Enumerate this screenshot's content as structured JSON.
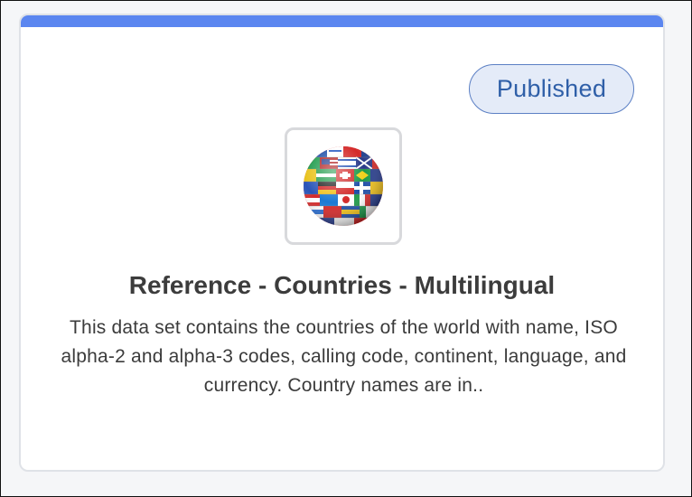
{
  "card": {
    "status": "Published",
    "title": "Reference - Countries - Multilingual",
    "description": "This data set contains the countries of the world with name, ISO alpha-2 and alpha-3 codes, calling code, continent, language, and currency. Country names are in..",
    "thumbnail_icon": "flag-globe-icon"
  },
  "colors": {
    "accent": "#5b86f0",
    "badge_bg": "#e4ebf8",
    "badge_text": "#2f5fa8"
  }
}
